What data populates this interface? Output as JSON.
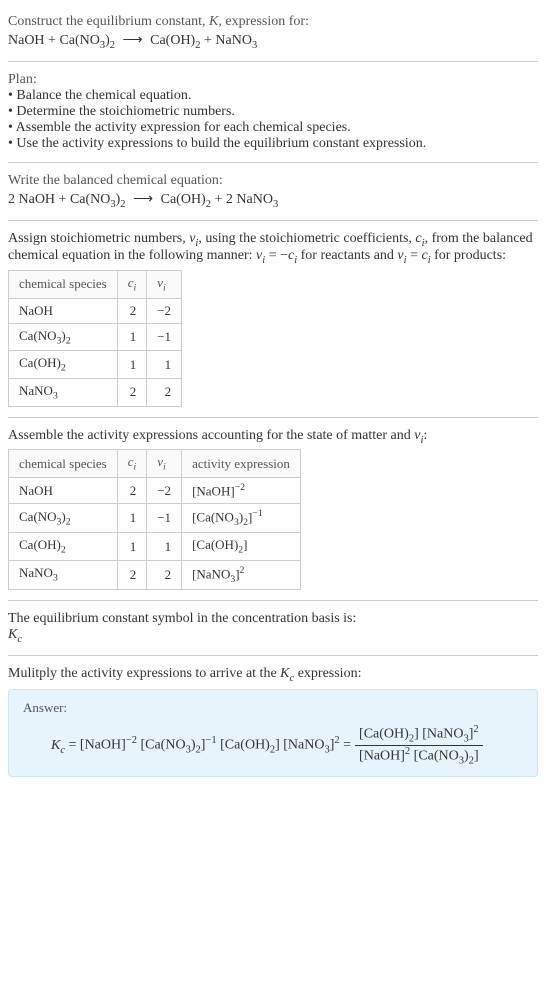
{
  "header": {
    "title_html": "Construct the equilibrium constant, <span class='ital'>K</span>, expression for:",
    "equation_html": "NaOH + Ca(NO<sub>3</sub>)<sub>2</sub> <span class='arrow'>⟶</span> Ca(OH)<sub>2</sub> + NaNO<sub>3</sub>"
  },
  "plan": {
    "heading": "Plan:",
    "items": [
      "• Balance the chemical equation.",
      "• Determine the stoichiometric numbers.",
      "• Assemble the activity expression for each chemical species.",
      "• Use the activity expressions to build the equilibrium constant expression."
    ]
  },
  "balanced": {
    "title": "Write the balanced chemical equation:",
    "equation_html": "2 NaOH + Ca(NO<sub>3</sub>)<sub>2</sub> <span class='arrow'>⟶</span> Ca(OH)<sub>2</sub> + 2 NaNO<sub>3</sub>"
  },
  "stoich": {
    "intro_html": "Assign stoichiometric numbers, <span class='ital'>ν<sub>i</sub></span>, using the stoichiometric coefficients, <span class='ital'>c<sub>i</sub></span>, from the balanced chemical equation in the following manner: <span class='ital'>ν<sub>i</sub></span> = −<span class='ital'>c<sub>i</sub></span> for reactants and <span class='ital'>ν<sub>i</sub></span> = <span class='ital'>c<sub>i</sub></span> for products:",
    "headers": {
      "species": "chemical species",
      "ci_html": "<span class='ital'>c<sub>i</sub></span>",
      "vi_html": "<span class='ital'>ν<sub>i</sub></span>"
    },
    "rows": [
      {
        "species_html": "NaOH",
        "ci": "2",
        "vi": "−2"
      },
      {
        "species_html": "Ca(NO<sub>3</sub>)<sub>2</sub>",
        "ci": "1",
        "vi": "−1"
      },
      {
        "species_html": "Ca(OH)<sub>2</sub>",
        "ci": "1",
        "vi": "1"
      },
      {
        "species_html": "NaNO<sub>3</sub>",
        "ci": "2",
        "vi": "2"
      }
    ]
  },
  "activity": {
    "intro_html": "Assemble the activity expressions accounting for the state of matter and <span class='ital'>ν<sub>i</sub></span>:",
    "headers": {
      "species": "chemical species",
      "ci_html": "<span class='ital'>c<sub>i</sub></span>",
      "vi_html": "<span class='ital'>ν<sub>i</sub></span>",
      "activity": "activity expression"
    },
    "rows": [
      {
        "species_html": "NaOH",
        "ci": "2",
        "vi": "−2",
        "act_html": "[NaOH]<sup>−2</sup>"
      },
      {
        "species_html": "Ca(NO<sub>3</sub>)<sub>2</sub>",
        "ci": "1",
        "vi": "−1",
        "act_html": "[Ca(NO<sub>3</sub>)<sub>2</sub>]<sup>−1</sup>"
      },
      {
        "species_html": "Ca(OH)<sub>2</sub>",
        "ci": "1",
        "vi": "1",
        "act_html": "[Ca(OH)<sub>2</sub>]"
      },
      {
        "species_html": "NaNO<sub>3</sub>",
        "ci": "2",
        "vi": "2",
        "act_html": "[NaNO<sub>3</sub>]<sup>2</sup>"
      }
    ]
  },
  "basis": {
    "line1": "The equilibrium constant symbol in the concentration basis is:",
    "line2_html": "<span class='ital'>K<sub>c</sub></span>"
  },
  "multiply": {
    "text_html": "Mulitply the activity expressions to arrive at the <span class='ital'>K<sub>c</sub></span> expression:"
  },
  "answer": {
    "label": "Answer:",
    "lhs_html": "<span class='ital'>K<sub>c</sub></span> = [NaOH]<sup>−2</sup> [Ca(NO<sub>3</sub>)<sub>2</sub>]<sup>−1</sup> [Ca(OH)<sub>2</sub>] [NaNO<sub>3</sub>]<sup>2</sup> =",
    "frac_num_html": "[Ca(OH)<sub>2</sub>] [NaNO<sub>3</sub>]<sup>2</sup>",
    "frac_den_html": "[NaOH]<sup>2</sup> [Ca(NO<sub>3</sub>)<sub>2</sub>]"
  }
}
